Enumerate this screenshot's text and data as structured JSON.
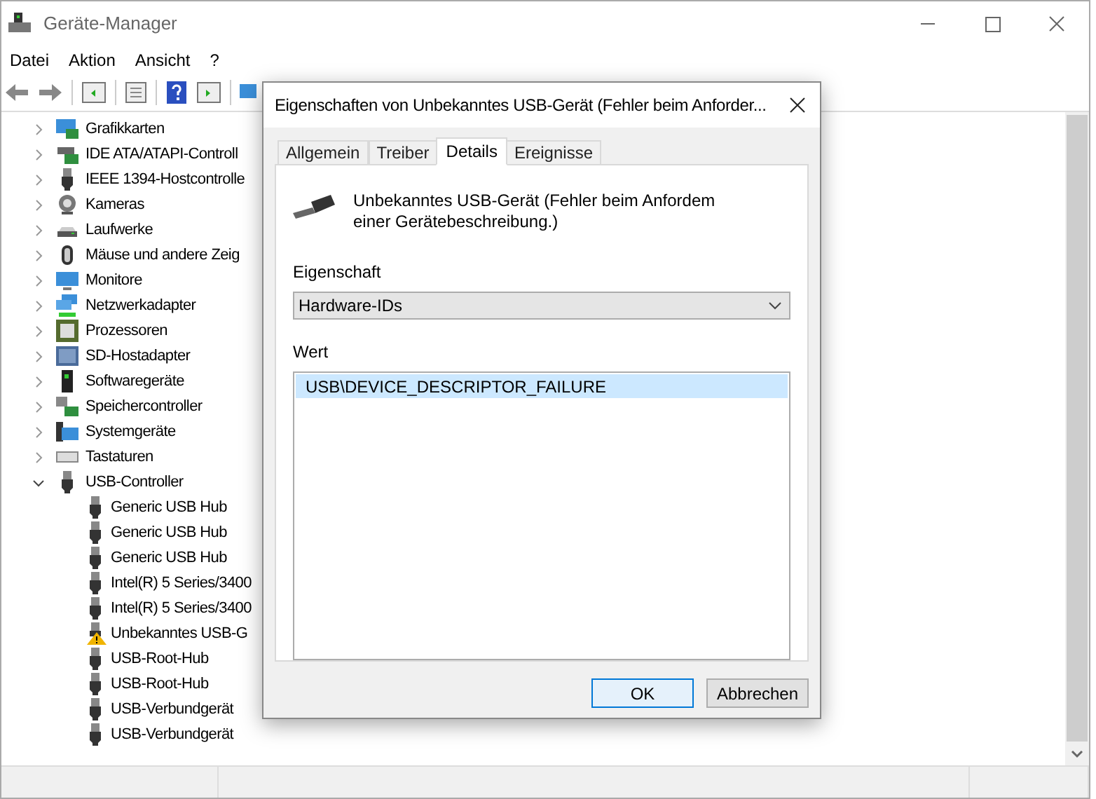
{
  "window": {
    "title": "Geräte-Manager"
  },
  "menu": [
    "Datei",
    "Aktion",
    "Ansicht",
    "?"
  ],
  "tree": [
    {
      "label": "Grafikkarten",
      "kind": "display",
      "expanded": false
    },
    {
      "label": "IDE ATA/ATAPI-Controll",
      "kind": "controller",
      "expanded": false
    },
    {
      "label": "IEEE 1394-Hostcontrolle",
      "kind": "plug",
      "expanded": false
    },
    {
      "label": "Kameras",
      "kind": "camera",
      "expanded": false
    },
    {
      "label": "Laufwerke",
      "kind": "drive",
      "expanded": false
    },
    {
      "label": "Mäuse und andere Zeig",
      "kind": "mouse",
      "expanded": false
    },
    {
      "label": "Monitore",
      "kind": "monitor",
      "expanded": false
    },
    {
      "label": "Netzwerkadapter",
      "kind": "network",
      "expanded": false
    },
    {
      "label": "Prozessoren",
      "kind": "cpu",
      "expanded": false
    },
    {
      "label": "SD-Hostadapter",
      "kind": "card",
      "expanded": false
    },
    {
      "label": "Softwaregeräte",
      "kind": "software",
      "expanded": false
    },
    {
      "label": "Speichercontroller",
      "kind": "storage",
      "expanded": false
    },
    {
      "label": "Systemgeräte",
      "kind": "system",
      "expanded": false
    },
    {
      "label": "Tastaturen",
      "kind": "keyboard",
      "expanded": false
    },
    {
      "label": "USB-Controller",
      "kind": "plug",
      "expanded": true,
      "children": [
        {
          "label": "Generic USB Hub",
          "kind": "plug"
        },
        {
          "label": "Generic USB Hub",
          "kind": "plug"
        },
        {
          "label": "Generic USB Hub",
          "kind": "plug"
        },
        {
          "label": "Intel(R) 5 Series/3400",
          "kind": "plug"
        },
        {
          "label": "Intel(R) 5 Series/3400",
          "kind": "plug"
        },
        {
          "label": "Unbekanntes USB-G",
          "kind": "warning"
        },
        {
          "label": "USB-Root-Hub",
          "kind": "plug"
        },
        {
          "label": "USB-Root-Hub",
          "kind": "plug"
        },
        {
          "label": "USB-Verbundgerät",
          "kind": "plug"
        },
        {
          "label": "USB-Verbundgerät",
          "kind": "plug"
        }
      ]
    }
  ],
  "dialog": {
    "title": "Eigenschaften von Unbekanntes USB-Gerät (Fehler beim Anforder...",
    "tabs": [
      {
        "label": "Allgemein",
        "selected": false
      },
      {
        "label": "Treiber",
        "selected": false
      },
      {
        "label": "Details",
        "selected": true
      },
      {
        "label": "Ereignisse",
        "selected": false
      }
    ],
    "device_description": "Unbekanntes USB-Gerät (Fehler beim Anfordem einer Gerätebeschreibung.)",
    "property_label": "Eigenschaft",
    "property_value": "Hardware-IDs",
    "value_label": "Wert",
    "values": [
      {
        "text": "USB\\DEVICE_DESCRIPTOR_FAILURE",
        "selected": true
      }
    ],
    "buttons": [
      {
        "label": "OK",
        "default": true
      },
      {
        "label": "Abbrechen",
        "default": false
      }
    ]
  }
}
